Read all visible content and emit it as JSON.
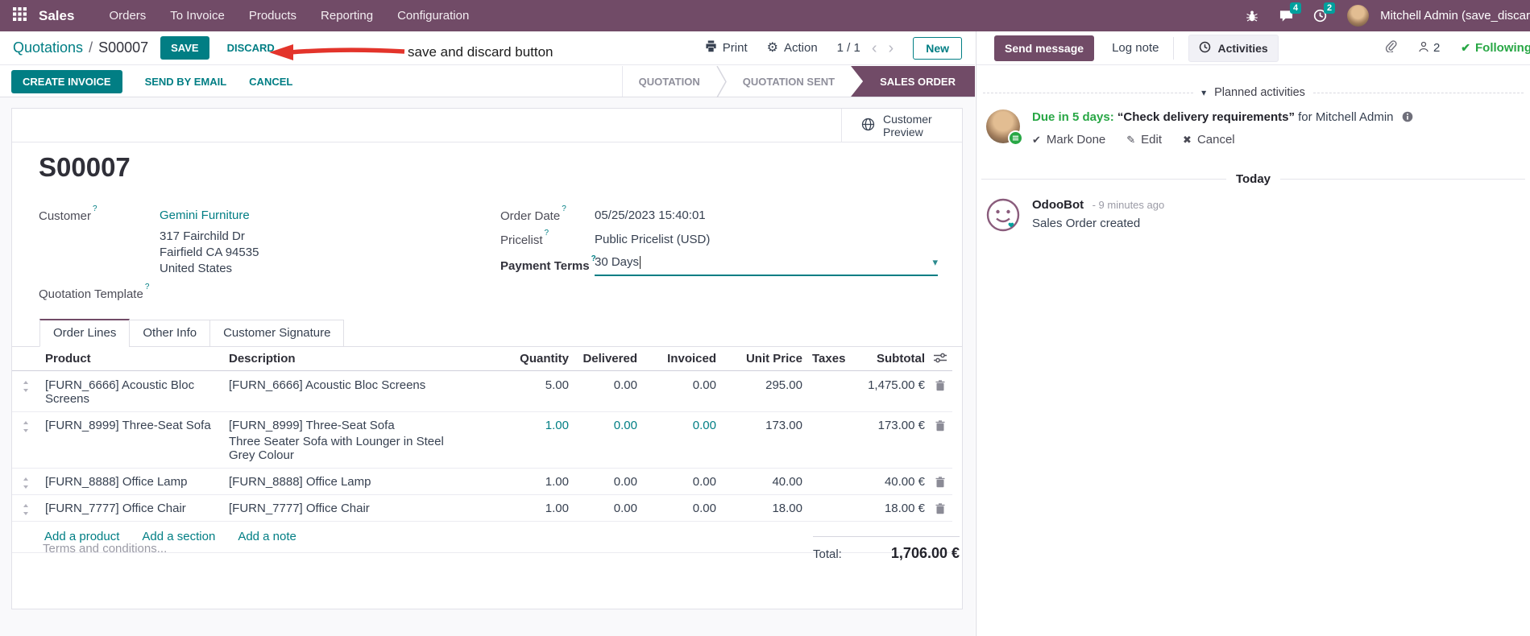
{
  "colors": {
    "nav_purple": "#714B67",
    "accent_teal": "#017E84",
    "badge_teal": "#00A09D",
    "status_active_purple": "#714B67",
    "green": "#28a745",
    "annotation_red": "#e3342b"
  },
  "icons": {
    "slash": "/",
    "chevron_left": "‹",
    "chevron_right": "›",
    "caret_down": "▾",
    "collapse_caret": "▾",
    "check": "✔",
    "pencil": "✎",
    "x_mark": "✖",
    "gear": "⚙"
  },
  "nav": {
    "app_name": "Sales",
    "menus": [
      "Orders",
      "To Invoice",
      "Products",
      "Reporting",
      "Configuration"
    ],
    "message_badge": "4",
    "activity_badge": "2",
    "user_name": "Mitchell Admin (save_discar"
  },
  "control_panel": {
    "breadcrumb_parent": "Quotations",
    "breadcrumb_current": "S00007",
    "save": "SAVE",
    "discard": "DISCARD",
    "print": "Print",
    "action": "Action",
    "pager": "1 / 1",
    "new": "New"
  },
  "annotation": {
    "text": "save and discard button"
  },
  "header_buttons": [
    "CREATE INVOICE",
    "SEND BY EMAIL",
    "CANCEL"
  ],
  "statusbar": {
    "steps": [
      "QUOTATION",
      "QUOTATION SENT",
      "SALES ORDER"
    ],
    "active": "SALES ORDER"
  },
  "sheet": {
    "preview_button": "Customer Preview",
    "title": "S00007",
    "help_marker": "?",
    "fields": {
      "customer_label": "Customer",
      "customer_name": "Gemini Furniture",
      "customer_address": [
        "317 Fairchild Dr",
        "Fairfield CA 94535",
        "United States"
      ],
      "quotation_template_label": "Quotation Template",
      "order_date_label": "Order Date",
      "order_date_value": "05/25/2023 15:40:01",
      "pricelist_label": "Pricelist",
      "pricelist_value": "Public Pricelist (USD)",
      "payment_terms_label": "Payment Terms",
      "payment_terms_value": "30 Days"
    },
    "tabs": [
      "Order Lines",
      "Other Info",
      "Customer Signature"
    ],
    "order_lines": {
      "columns": [
        "Product",
        "Description",
        "Quantity",
        "Delivered",
        "Invoiced",
        "Unit Price",
        "Taxes",
        "Subtotal"
      ],
      "rows": [
        {
          "product": "[FURN_6666] Acoustic Bloc Screens",
          "description": "[FURN_6666] Acoustic Bloc Screens",
          "description2": "",
          "quantity": "5.00",
          "delivered": "0.00",
          "invoiced": "0.00",
          "unit_price": "295.00",
          "taxes": "",
          "subtotal": "1,475.00 €"
        },
        {
          "product": "[FURN_8999] Three-Seat Sofa",
          "description": "[FURN_8999] Three-Seat Sofa",
          "description2": "Three Seater Sofa with Lounger in Steel Grey Colour",
          "quantity": "1.00",
          "delivered": "0.00",
          "invoiced": "0.00",
          "unit_price": "173.00",
          "taxes": "",
          "subtotal": "173.00 €"
        },
        {
          "product": "[FURN_8888] Office Lamp",
          "description": "[FURN_8888] Office Lamp",
          "description2": "",
          "quantity": "1.00",
          "delivered": "0.00",
          "invoiced": "0.00",
          "unit_price": "40.00",
          "taxes": "",
          "subtotal": "40.00 €"
        },
        {
          "product": "[FURN_7777] Office Chair",
          "description": "[FURN_7777] Office Chair",
          "description2": "",
          "quantity": "1.00",
          "delivered": "0.00",
          "invoiced": "0.00",
          "unit_price": "18.00",
          "taxes": "",
          "subtotal": "18.00 €"
        }
      ],
      "footer_links": [
        "Add a product",
        "Add a section",
        "Add a note"
      ]
    },
    "terms_placeholder": "Terms and conditions...",
    "total_label": "Total:",
    "total_value": "1,706.00 €"
  },
  "chatter": {
    "send_message": "Send message",
    "log_note": "Log note",
    "activities": "Activities",
    "followers_count": "2",
    "following": "Following",
    "planned_header": "Planned activities",
    "activity": {
      "due": "Due in 5 days:",
      "summary": "“Check delivery requirements”",
      "assignee": "for Mitchell Admin",
      "mark_done": "Mark Done",
      "edit": "Edit",
      "cancel": "Cancel"
    },
    "today": "Today",
    "message": {
      "author": "OdooBot",
      "time": "- 9 minutes ago",
      "body": "Sales Order created"
    }
  }
}
